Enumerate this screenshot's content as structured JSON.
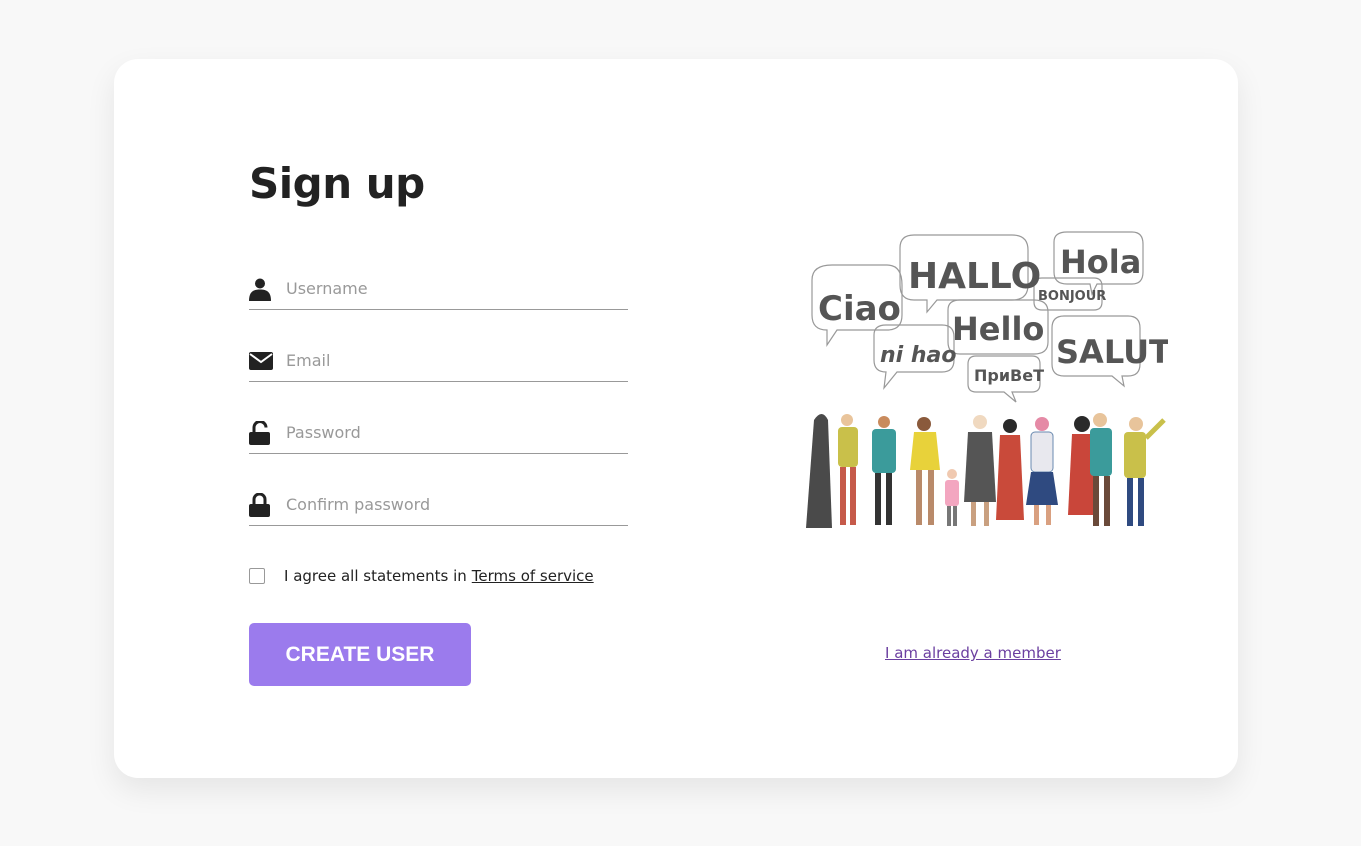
{
  "form": {
    "title": "Sign up",
    "fields": [
      {
        "name": "username",
        "placeholder": "Username",
        "value": "",
        "icon": "user-icon"
      },
      {
        "name": "email",
        "placeholder": "Email",
        "value": "",
        "icon": "envelope-icon"
      },
      {
        "name": "password",
        "placeholder": "Password",
        "value": "",
        "icon": "unlock-icon"
      },
      {
        "name": "confirm_password",
        "placeholder": "Confirm password",
        "value": "",
        "icon": "lock-icon"
      }
    ],
    "agree_text": "I agree all statements in",
    "terms_link": "Terms of service",
    "submit_label": "CREATE USER"
  },
  "side": {
    "member_link": "I am already a member",
    "greetings": [
      "Ciao",
      "HALLO",
      "Hola",
      "BONJOUR",
      "Hello",
      "ni hao",
      "SALUT",
      "ПриВеТ"
    ]
  },
  "colors": {
    "accent": "#9b7bed",
    "link": "#6b3fa0",
    "text": "#222222",
    "muted": "#999999",
    "background": "#f8f8f8",
    "card": "#ffffff"
  }
}
